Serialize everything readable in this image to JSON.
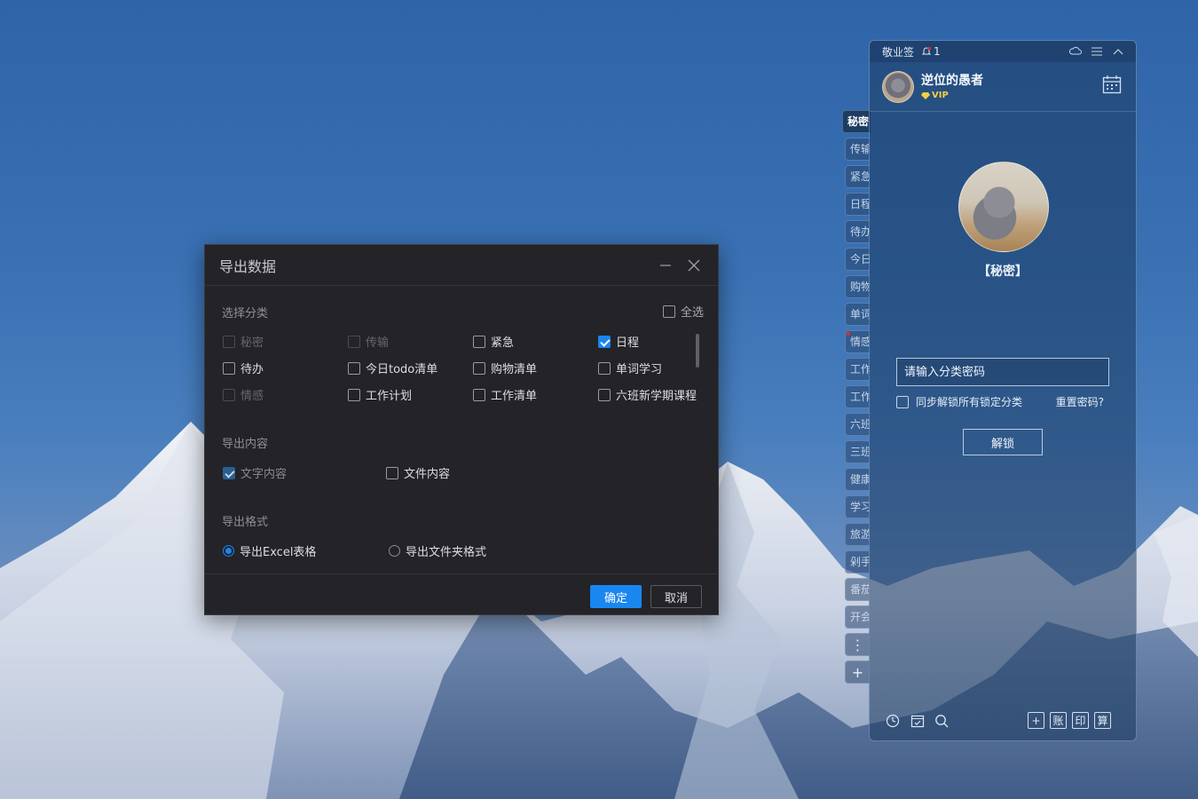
{
  "dialog": {
    "title": "导出数据",
    "category_section": {
      "label": "选择分类",
      "select_all_label": "全选",
      "items": [
        {
          "label": "秘密",
          "checked": false,
          "disabled": true
        },
        {
          "label": "传输",
          "checked": false,
          "disabled": true
        },
        {
          "label": "紧急",
          "checked": false,
          "disabled": false
        },
        {
          "label": "日程",
          "checked": true,
          "disabled": false
        },
        {
          "label": "待办",
          "checked": false,
          "disabled": false
        },
        {
          "label": "今日todo清单",
          "checked": false,
          "disabled": false
        },
        {
          "label": "购物清单",
          "checked": false,
          "disabled": false
        },
        {
          "label": "单词学习",
          "checked": false,
          "disabled": false
        },
        {
          "label": "情感",
          "checked": false,
          "disabled": true
        },
        {
          "label": "工作计划",
          "checked": false,
          "disabled": false
        },
        {
          "label": "工作清单",
          "checked": false,
          "disabled": false
        },
        {
          "label": "六班新学期课程",
          "checked": false,
          "disabled": false
        }
      ]
    },
    "content_section": {
      "label": "导出内容",
      "items": [
        {
          "label": "文字内容",
          "checked": true,
          "disabled": true
        },
        {
          "label": "文件内容",
          "checked": false,
          "disabled": false
        }
      ]
    },
    "format_section": {
      "label": "导出格式",
      "options": [
        {
          "label": "导出Excel表格",
          "selected": true
        },
        {
          "label": "导出文件夹格式",
          "selected": false
        }
      ]
    },
    "ok_label": "确定",
    "cancel_label": "取消"
  },
  "side_tabs": [
    {
      "label": "秘密",
      "active": true
    },
    {
      "label": "传输"
    },
    {
      "label": "紧急"
    },
    {
      "label": "日程"
    },
    {
      "label": "待办"
    },
    {
      "label": "今日"
    },
    {
      "label": "购物"
    },
    {
      "label": "单词"
    },
    {
      "label": "情感",
      "flag": true
    },
    {
      "label": "工作"
    },
    {
      "label": "工作"
    },
    {
      "label": "六班"
    },
    {
      "label": "三班"
    },
    {
      "label": "健康"
    },
    {
      "label": "学习"
    },
    {
      "label": "旅游"
    },
    {
      "label": "剁手"
    },
    {
      "label": "番茄"
    },
    {
      "label": "开会"
    }
  ],
  "panel": {
    "app_name": "敬业签",
    "notification_count": "1",
    "username": "逆位的愚者",
    "vip_label": "VIP",
    "category_title": "【秘密】",
    "password_placeholder": "请输入分类密码",
    "sync_unlock_label": "同步解锁所有锁定分类",
    "reset_password_label": "重置密码?",
    "unlock_label": "解锁",
    "bottom_right_buttons": [
      "+",
      "账",
      "印",
      "算"
    ]
  },
  "colors": {
    "accent": "#1a86f0",
    "dialog_bg": "#232328",
    "vip_gold": "#f4d03f"
  }
}
